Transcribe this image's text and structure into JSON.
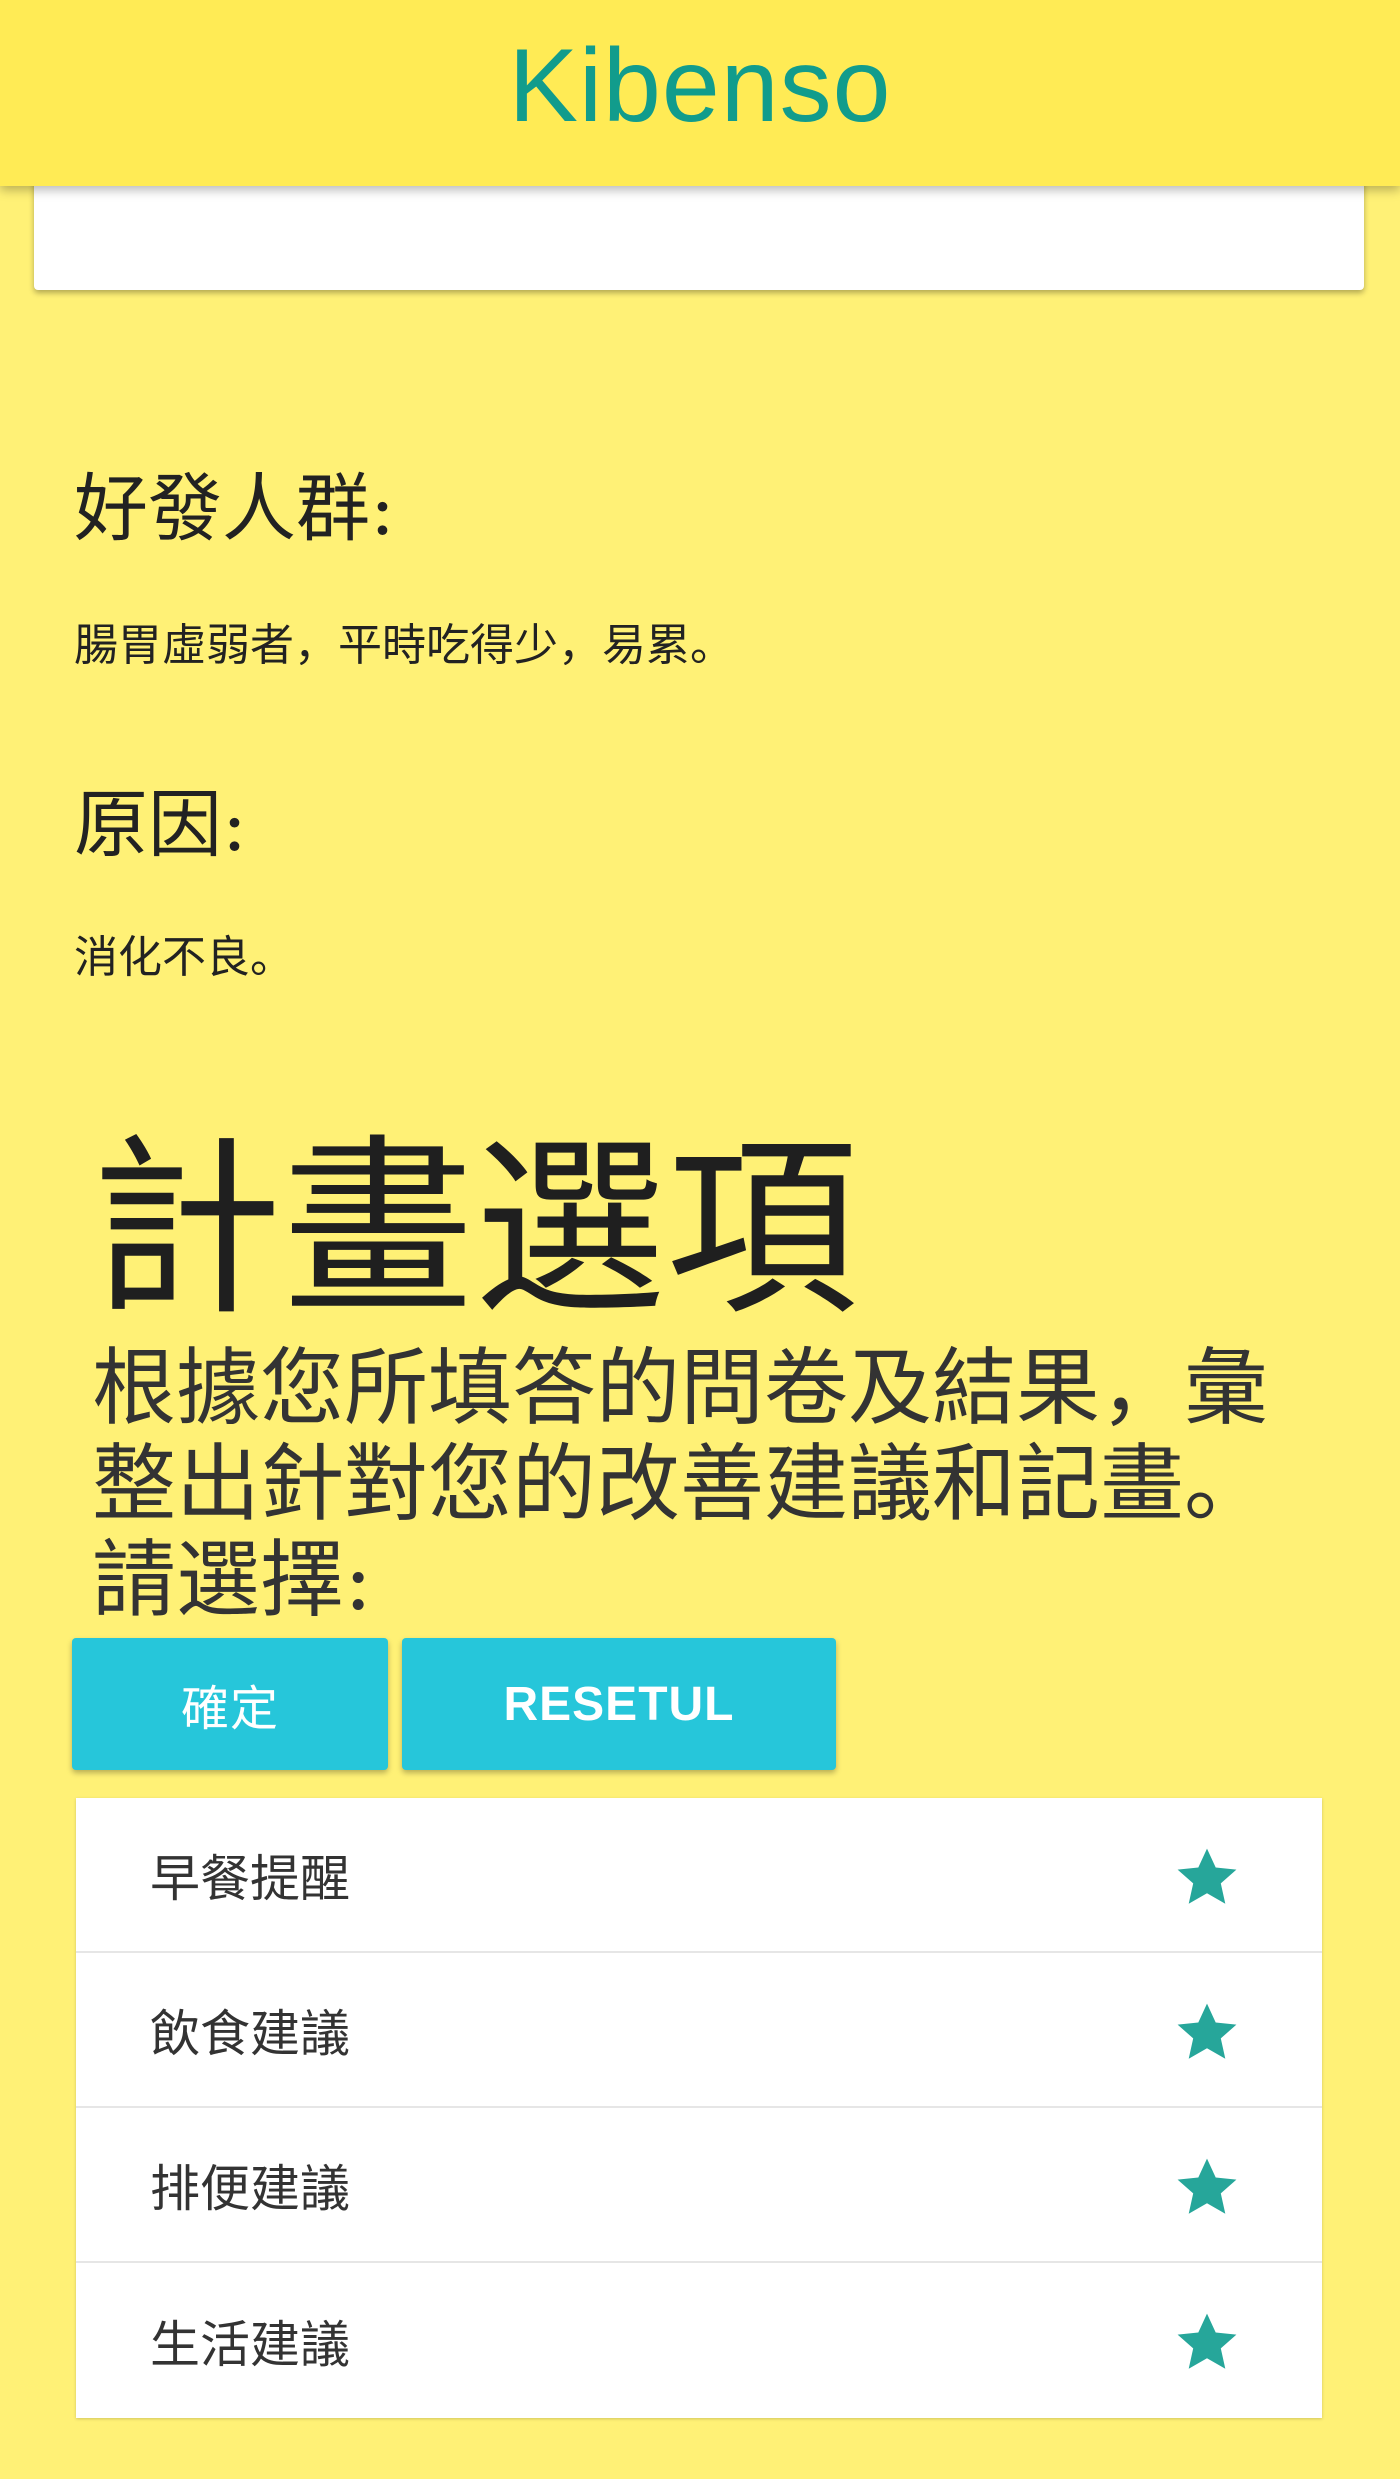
{
  "app": {
    "title": "Kibenso",
    "brand_color": "#119c8c",
    "appbar_color": "#ffeb55",
    "background_color": "#fff176"
  },
  "sections": {
    "population": {
      "heading": "好發人群:",
      "text": "腸胃虛弱者，平時吃得少，易累。"
    },
    "cause": {
      "heading": "原因:",
      "text": "消化不良。"
    }
  },
  "plan": {
    "title": "計畫選項",
    "description": "根據您所填答的問卷及結果，彙整出針對您的改善建議和記畫。請選擇:",
    "confirm_label": "確定",
    "reset_label": "RESETUL",
    "button_color": "#26c6da",
    "star_color": "#26a69a",
    "options": [
      {
        "label": "早餐提醒",
        "icon": "star-icon"
      },
      {
        "label": "飲食建議",
        "icon": "star-icon"
      },
      {
        "label": "排便建議",
        "icon": "star-icon"
      },
      {
        "label": "生活建議",
        "icon": "star-icon"
      }
    ]
  }
}
